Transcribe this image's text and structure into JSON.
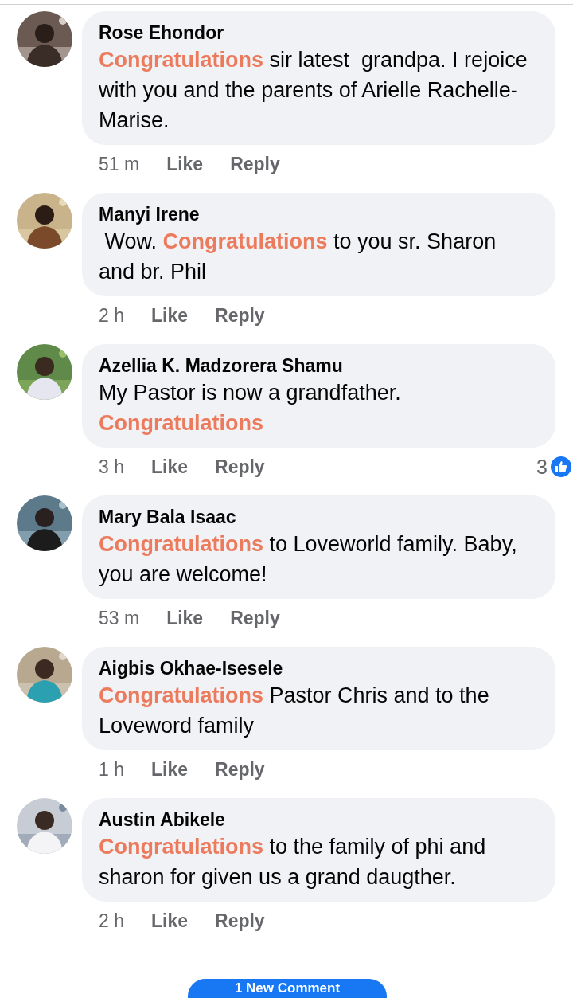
{
  "comments": [
    {
      "author": "Rose Ehondor",
      "text": "**Congratulations** sir latest  grandpa. I rejoice with you and the parents of Arielle Rachelle-Marise.",
      "time": "51 m",
      "actions": [
        "Like",
        "Reply"
      ]
    },
    {
      "author": "Manyi Irene",
      "text": " Wow. **Congratulations** to you sr. Sharon and br. Phil",
      "time": "2 h",
      "actions": [
        "Like",
        "Reply"
      ]
    },
    {
      "author": "Azellia K. Madzorera Shamu",
      "text": "My Pastor is now a grandfather. **Congratulations**",
      "time": "3 h",
      "actions": [
        "Like",
        "Reply"
      ],
      "reaction_count": "3"
    },
    {
      "author": "Mary Bala Isaac",
      "text": "**Congratulations** to Loveworld family. Baby, you are welcome!",
      "time": "53 m",
      "actions": [
        "Like",
        "Reply"
      ]
    },
    {
      "author": "Aigbis Okhae-Isesele",
      "text": "**Congratulations** Pastor Chris and to the Loveword family",
      "time": "1 h",
      "actions": [
        "Like",
        "Reply"
      ]
    },
    {
      "author": "Austin Abikele",
      "text": "**Congratulations** to the family of phi and sharon for given us a grand daugther.",
      "time": "2 h",
      "actions": [
        "Like",
        "Reply"
      ]
    }
  ],
  "new_comment_button": "1 New Comment"
}
